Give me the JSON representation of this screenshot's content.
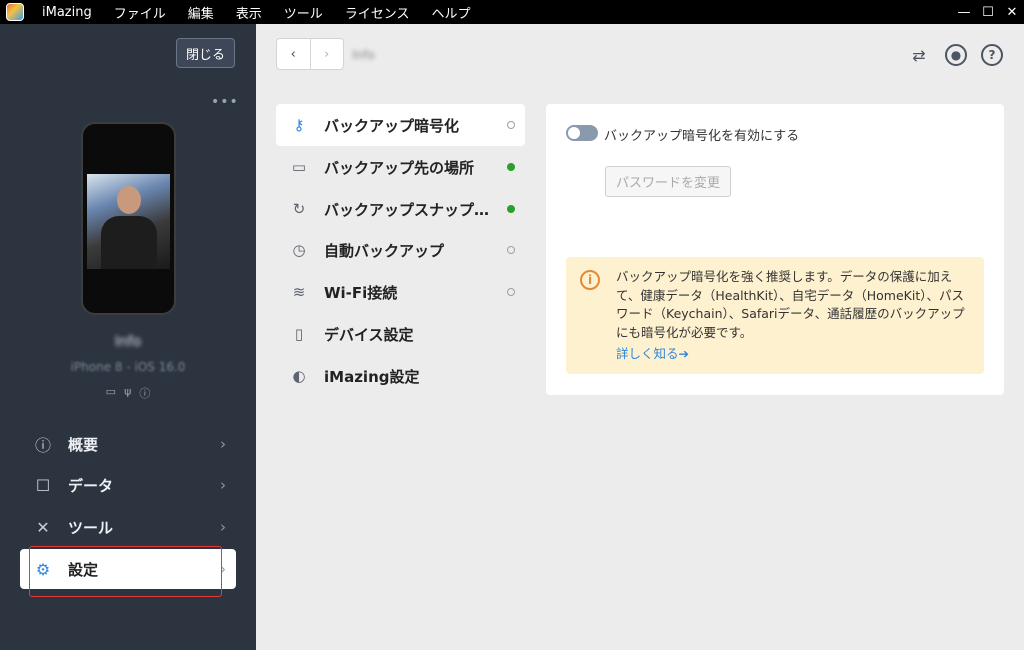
{
  "titlebar": {
    "app_name": "iMazing",
    "menus": [
      "ファイル",
      "編集",
      "表示",
      "ツール",
      "ライセンス",
      "ヘルプ"
    ],
    "controls": [
      "—",
      "☐",
      "✕"
    ]
  },
  "sidebar": {
    "close_label": "閉じる",
    "more_label": "•••",
    "device_name": "Info",
    "device_model": "iPhone 8 - iOS 16.0",
    "nav": [
      {
        "label": "概要",
        "icon": "info-icon"
      },
      {
        "label": "データ",
        "icon": "square-icon"
      },
      {
        "label": "ツール",
        "icon": "tools-icon"
      },
      {
        "label": "設定",
        "icon": "gear-icon"
      }
    ],
    "chevron": "›",
    "active_index": 3
  },
  "toolbar": {
    "back": "‹",
    "forward": "›",
    "breadcrumb": "Info"
  },
  "settings_menu": [
    {
      "label": "バックアップ暗号化",
      "icon": "key-icon",
      "status": "off",
      "active": true
    },
    {
      "label": "バックアップ先の場所",
      "icon": "folder-icon",
      "status": "on"
    },
    {
      "label": "バックアップスナップショット",
      "icon": "snapshot-icon",
      "status": "on"
    },
    {
      "label": "自動バックアップ",
      "icon": "clock-icon",
      "status": "off"
    },
    {
      "label": "Wi-Fi接続",
      "icon": "wifi-icon",
      "status": "off"
    },
    {
      "label": "デバイス設定",
      "icon": "device-settings-icon",
      "status": "none"
    },
    {
      "label": "iMazing設定",
      "icon": "imazing-icon",
      "status": "none"
    }
  ],
  "detail": {
    "toggle_label": "バックアップ暗号化を有効にする",
    "toggle_enabled": false,
    "password_button": "パスワードを変更",
    "info_text": "バックアップ暗号化を強く推奨します。データの保護に加えて、健康データ（HealthKit）、自宅データ（HomeKit）、パスワード（Keychain）、Safariデータ、通話履歴のバックアップにも暗号化が必要です。",
    "learn_more": "詳しく知る➔"
  },
  "colors": {
    "sidebar_bg": "#2c3440",
    "accent": "#2e86de",
    "status_on": "#2aa02a",
    "info_bg": "#fdf1cf",
    "highlight": "#e53935"
  }
}
